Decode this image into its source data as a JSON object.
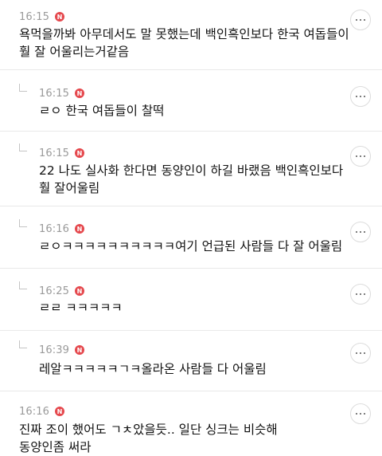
{
  "comments": [
    {
      "time": "16:15",
      "badge": "N",
      "is_reply": false,
      "lines": [
        "욕먹을까봐 아무데서도 말 못했는데 백인흑인보다 한국 여돕들이",
        "훨 잘 어울리는거같음"
      ]
    },
    {
      "time": "16:15",
      "badge": "N",
      "is_reply": true,
      "lines": [
        "ㄹㅇ 한국 여돕들이 찰떡"
      ]
    },
    {
      "time": "16:15",
      "badge": "N",
      "is_reply": true,
      "lines": [
        "22 나도 실사화 한다면 동양인이 하길 바랬음 백인흑인보다",
        "훨 잘어울림"
      ]
    },
    {
      "time": "16:16",
      "badge": "N",
      "is_reply": true,
      "lines": [
        "ㄹㅇㅋㅋㅋㅋㅋㅋㅋㅋㅋㅋ여기 언급된 사람들 다 잘 어울림"
      ]
    },
    {
      "time": "16:25",
      "badge": "N",
      "is_reply": true,
      "lines": [
        "ㄹㄹ ㅋㅋㅋㅋㅋ"
      ]
    },
    {
      "time": "16:39",
      "badge": "N",
      "is_reply": true,
      "lines": [
        "레알ㅋㅋㅋㅋㅋㄱㅋ올라온 사람들 다 어울림"
      ]
    },
    {
      "time": "16:16",
      "badge": "N",
      "is_reply": false,
      "lines": [
        "진짜 조이 했어도 ㄱㅊ았을듯.. 일단 싱크는 비슷해",
        "동양인좀 써라"
      ]
    }
  ],
  "icons": {
    "more": "more-horizontal-icon",
    "reply": "reply-arrow-icon",
    "new": "new-badge-icon"
  },
  "colors": {
    "badge": "#e5484d",
    "time": "#9a9a9a",
    "divider": "#e9e9e9"
  }
}
